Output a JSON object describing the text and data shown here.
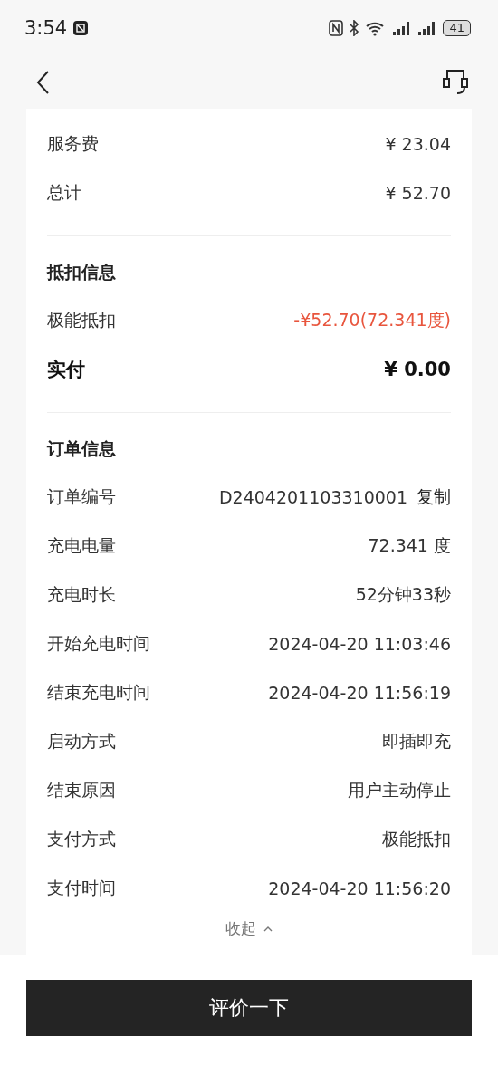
{
  "status_bar": {
    "time": "3:54",
    "battery": "41"
  },
  "fee_rows": [
    {
      "label": "服务费",
      "value": "¥ 23.04"
    },
    {
      "label": "总计",
      "value": "¥ 52.70"
    }
  ],
  "deduction": {
    "title": "抵扣信息",
    "rows": [
      {
        "kind": "discount",
        "label": "极能抵扣",
        "value": "-¥52.70(72.341度)"
      },
      {
        "kind": "total",
        "label": "实付",
        "value": "¥ 0.00"
      }
    ]
  },
  "order": {
    "title": "订单信息",
    "rows": [
      {
        "label": "订单编号",
        "value": "D2404201103310001",
        "action": "复制"
      },
      {
        "label": "充电电量",
        "value": "72.341 度"
      },
      {
        "label": "充电时长",
        "value": "52分钟33秒"
      },
      {
        "label": "开始充电时间",
        "value": "2024-04-20 11:03:46"
      },
      {
        "label": "结束充电时间",
        "value": "2024-04-20 11:56:19"
      },
      {
        "label": "启动方式",
        "value": "即插即充"
      },
      {
        "label": "结束原因",
        "value": "用户主动停止"
      },
      {
        "label": "支付方式",
        "value": "极能抵扣"
      },
      {
        "label": "支付时间",
        "value": "2024-04-20 11:56:20"
      }
    ]
  },
  "collapse": "收起",
  "review_button": "评价一下"
}
